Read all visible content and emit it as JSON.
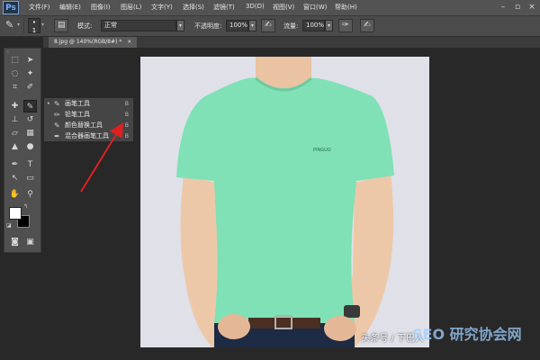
{
  "app": {
    "logo": "Ps"
  },
  "menubar": {
    "items": [
      "文件(F)",
      "编辑(E)",
      "图像(I)",
      "图层(L)",
      "文字(Y)",
      "选择(S)",
      "滤镜(T)",
      "3D(D)",
      "视图(V)",
      "窗口(W)",
      "帮助(H)"
    ]
  },
  "options": {
    "brush_size": "1",
    "mode_label": "模式:",
    "mode_value": "正常",
    "opacity_label": "不透明度:",
    "opacity_value": "100%",
    "flow_label": "流量:",
    "flow_value": "100%"
  },
  "document": {
    "tab_label": "8.jpg @ 140%(RGB/8#) *",
    "close": "×"
  },
  "flyout": {
    "items": [
      {
        "label": "画笔工具",
        "key": "B",
        "icon": "brush-icon",
        "glyph": "✎",
        "selected": true
      },
      {
        "label": "铅笔工具",
        "key": "B",
        "icon": "pencil-icon",
        "glyph": "✏",
        "selected": false
      },
      {
        "label": "颜色替换工具",
        "key": "B",
        "icon": "color-replace-icon",
        "glyph": "✎",
        "selected": false
      },
      {
        "label": "混合器画笔工具",
        "key": "B",
        "icon": "mixer-brush-icon",
        "glyph": "✒",
        "selected": false
      }
    ],
    "selected_mark": "•"
  },
  "canvas": {
    "shirt_color": "#7fe1b5",
    "chest_logo": "PINGUO"
  },
  "watermark": {
    "text": "头条号 / 下巴人",
    "logo": "SEO 研究协会网"
  },
  "colors": {
    "menubar": "#535353",
    "workspace": "#282828",
    "annotation_arrow": "#e02020"
  }
}
